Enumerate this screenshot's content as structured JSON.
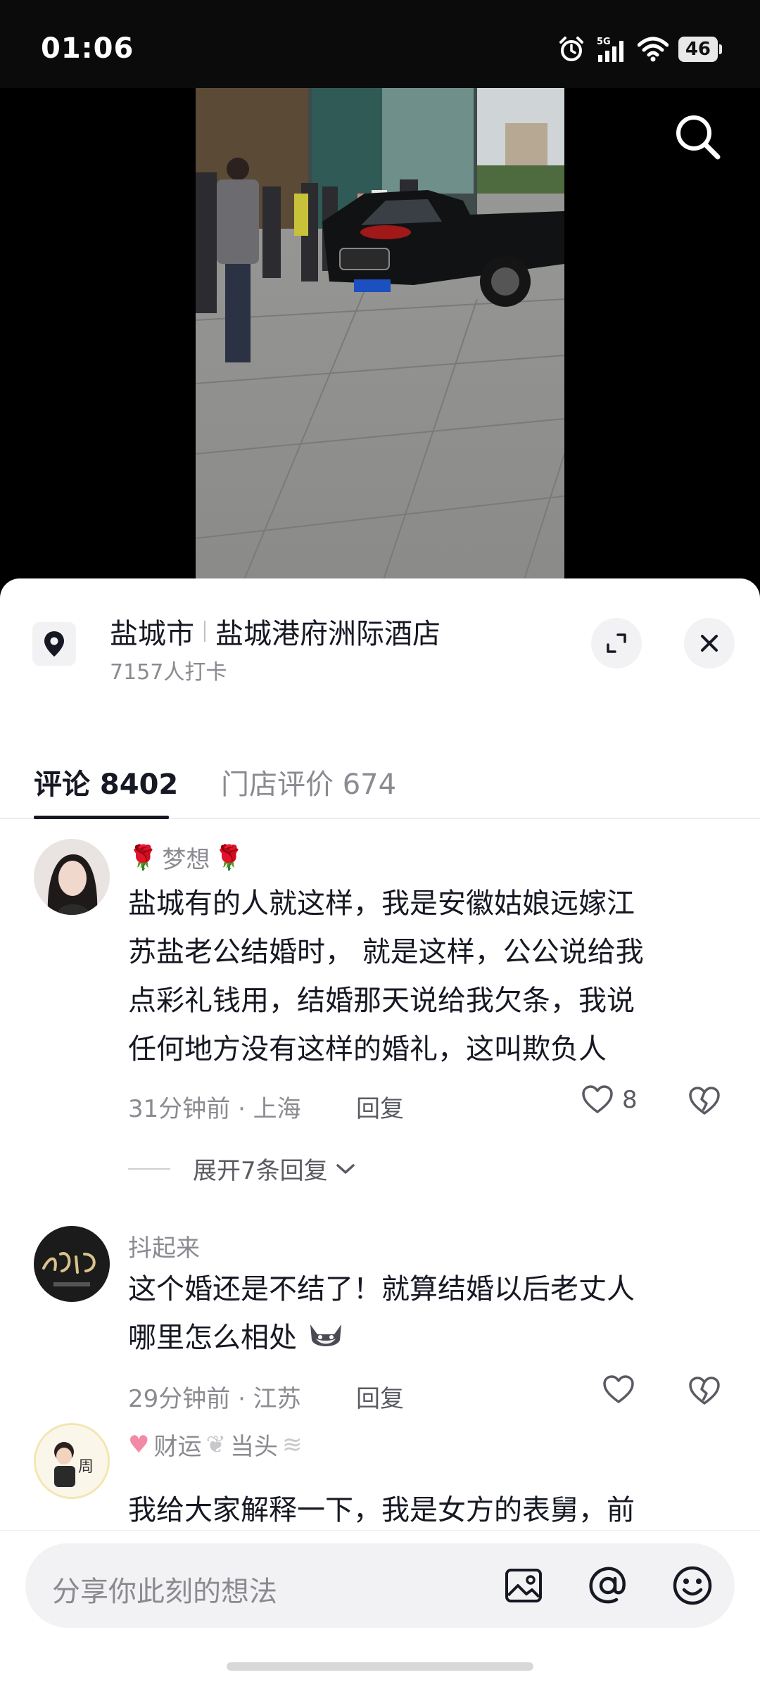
{
  "status_bar": {
    "time": "01:06",
    "network": "5G",
    "battery": "46"
  },
  "location": {
    "city": "盐城市",
    "place": "盐城港府洲际酒店",
    "checkins": "7157人打卡"
  },
  "tabs": [
    {
      "label": "评论 8402",
      "active": true
    },
    {
      "label": "门店评价 674",
      "active": false
    }
  ],
  "comments": [
    {
      "user": "梦想",
      "lines": [
        "盐城有的人就这样，我是安徽姑娘远嫁江",
        "苏盐老公结婚时， 就是这样，公公说给我",
        "点彩礼钱用，结婚那天说给我欠条，我说",
        "任何地方没有这样的婚礼，这叫欺负人"
      ],
      "meta": "31分钟前 · 上海",
      "reply": "回复",
      "likes": "8",
      "expand": "展开7条回复"
    },
    {
      "user": "抖起来",
      "lines": [
        "这个婚还是不结了！就算结婚以后老丈人",
        "哪里怎么相处"
      ],
      "meta": "29分钟前 · 江苏",
      "reply": "回复",
      "likes": ""
    },
    {
      "user": "财运",
      "user_suffix": "当头",
      "lines": [
        "我给大家解释一下，我是女方的表舅，前"
      ]
    }
  ],
  "composer": {
    "placeholder": "分享你此刻的想法"
  }
}
